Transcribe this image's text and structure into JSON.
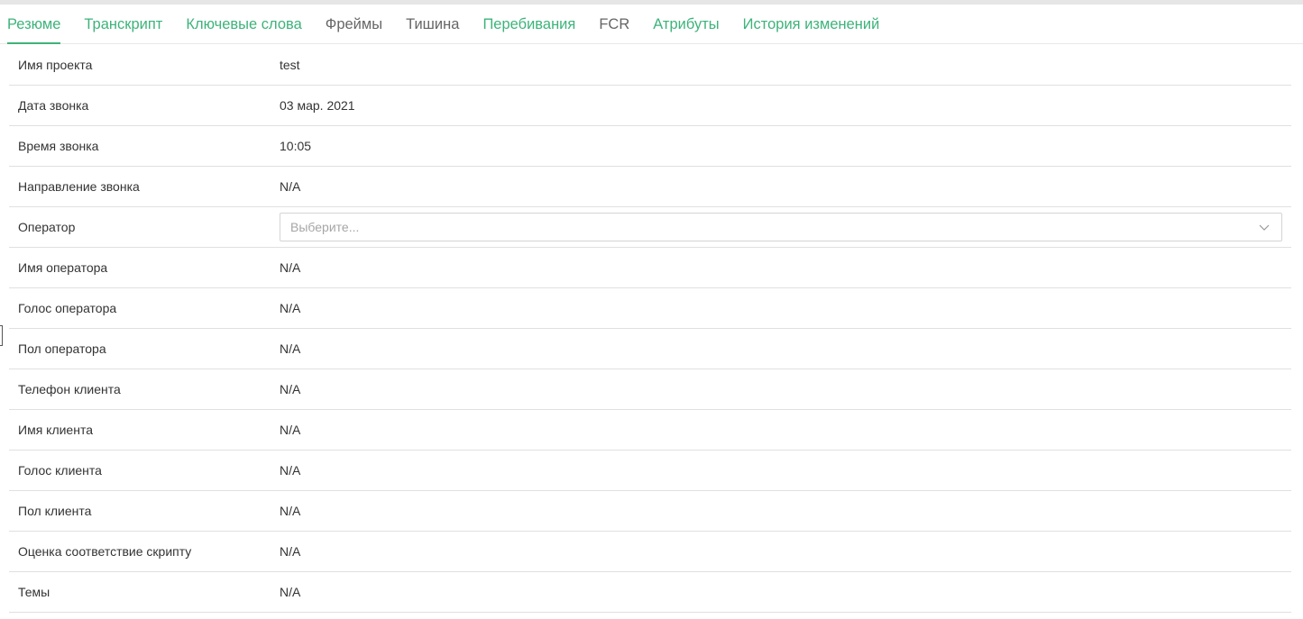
{
  "tabs": [
    {
      "label": "Резюме",
      "style": "green",
      "active": true
    },
    {
      "label": "Транскрипт",
      "style": "green"
    },
    {
      "label": "Ключевые слова",
      "style": "green"
    },
    {
      "label": "Фреймы",
      "style": "gray"
    },
    {
      "label": "Тишина",
      "style": "gray"
    },
    {
      "label": "Перебивания",
      "style": "green"
    },
    {
      "label": "FCR",
      "style": "gray"
    },
    {
      "label": "Атрибуты",
      "style": "green"
    },
    {
      "label": "История изменений",
      "style": "green"
    }
  ],
  "fields": [
    {
      "label": "Имя проекта",
      "value": "test"
    },
    {
      "label": "Дата звонка",
      "value": "03 мар. 2021"
    },
    {
      "label": "Время звонка",
      "value": "10:05"
    },
    {
      "label": "Направление звонка",
      "value": "N/A"
    },
    {
      "label": "Оператор",
      "type": "select",
      "placeholder": "Выберите..."
    },
    {
      "label": "Имя оператора",
      "value": "N/A"
    },
    {
      "label": "Голос оператора",
      "value": "N/A"
    },
    {
      "label": "Пол оператора",
      "value": "N/A"
    },
    {
      "label": "Телефон клиента",
      "value": "N/A"
    },
    {
      "label": "Имя клиента",
      "value": "N/A"
    },
    {
      "label": "Голос клиента",
      "value": "N/A"
    },
    {
      "label": "Пол клиента",
      "value": "N/A"
    },
    {
      "label": "Оценка соответствие скрипту",
      "value": "N/A"
    },
    {
      "label": "Темы",
      "value": "N/A"
    }
  ],
  "colors": {
    "accent": "#3db37a",
    "tab_gray": "#666666",
    "divider": "#e0e0e0"
  }
}
